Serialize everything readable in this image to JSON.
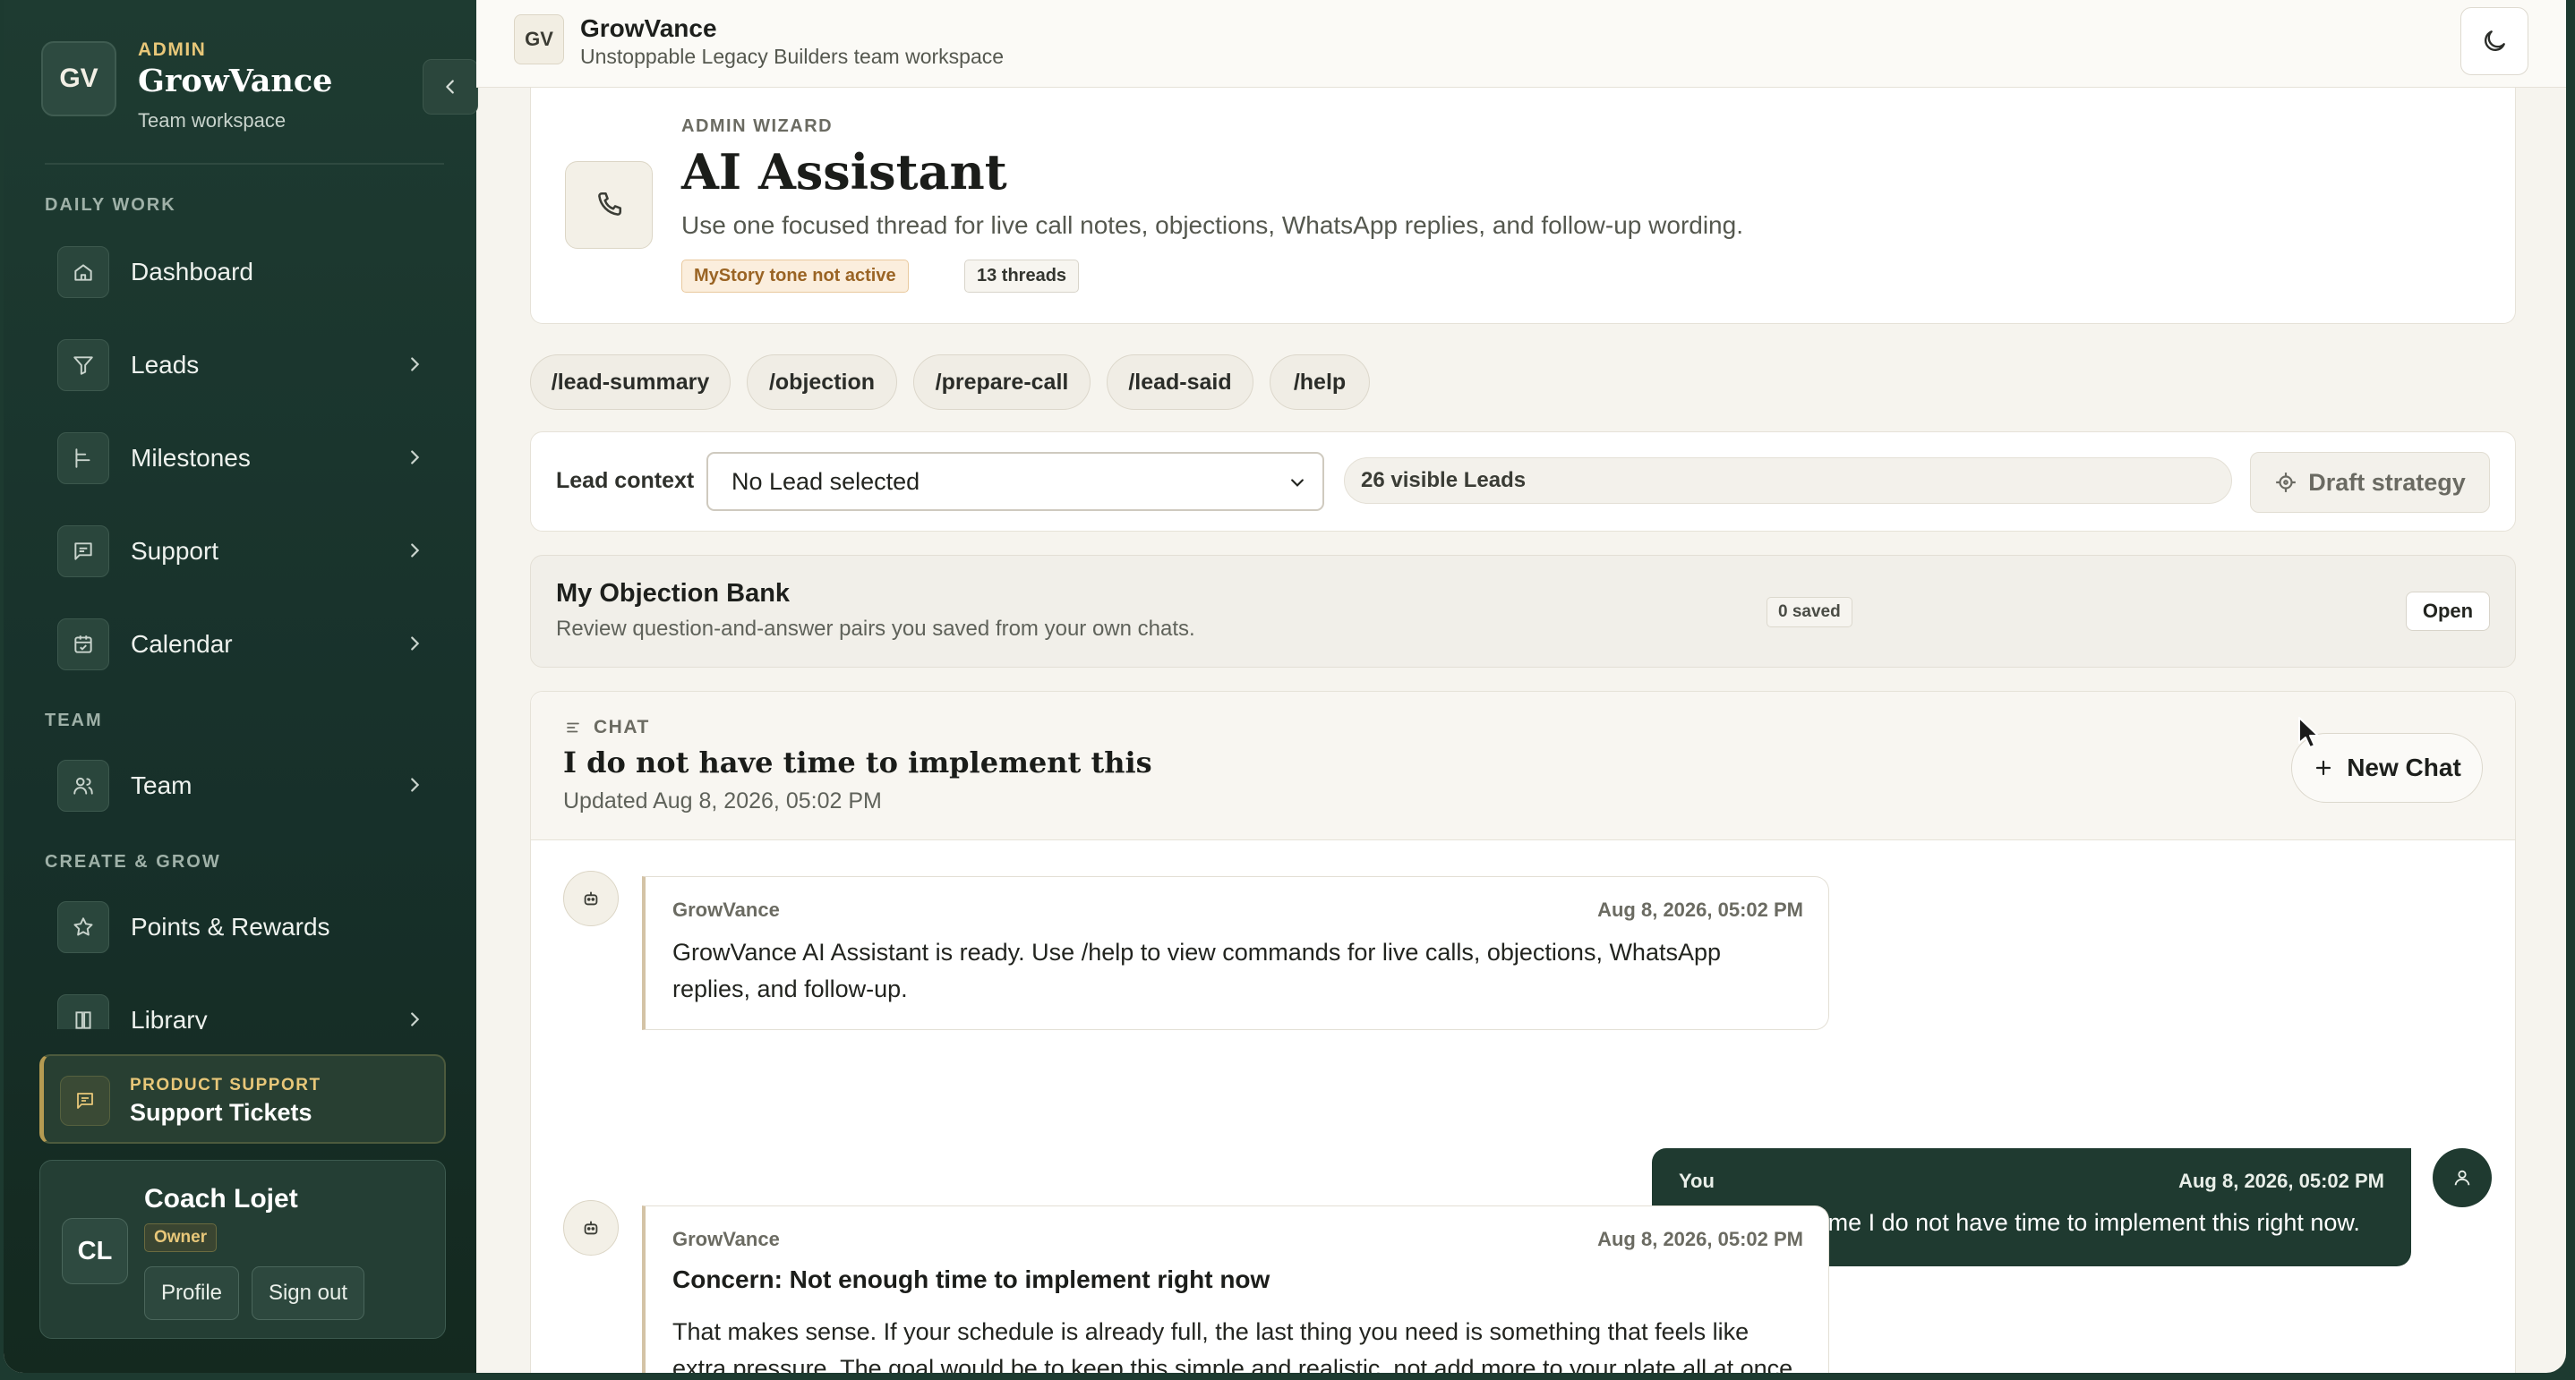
{
  "sidebar": {
    "role": "ADMIN",
    "brand_initials": "GV",
    "brand_name": "GrowVance",
    "brand_sub": "Team workspace",
    "sections": {
      "daily": "DAILY WORK",
      "team": "TEAM",
      "create": "CREATE & GROW"
    },
    "items": [
      {
        "label": "Dashboard",
        "icon": "home-icon"
      },
      {
        "label": "Leads",
        "icon": "filter-icon"
      },
      {
        "label": "Milestones",
        "icon": "milestone-icon"
      },
      {
        "label": "Support",
        "icon": "message-icon"
      },
      {
        "label": "Calendar",
        "icon": "calendar-icon"
      },
      {
        "label": "Team",
        "icon": "users-icon"
      },
      {
        "label": "Points & Rewards",
        "icon": "star-icon"
      },
      {
        "label": "Library",
        "icon": "book-icon"
      }
    ],
    "support": {
      "kicker": "PRODUCT SUPPORT",
      "title": "Support Tickets"
    },
    "user": {
      "initials": "CL",
      "name": "Coach Lojet",
      "role": "Owner",
      "profile_label": "Profile",
      "signout_label": "Sign out"
    }
  },
  "topbar": {
    "logo": "GV",
    "title": "GrowVance",
    "subtitle": "Unstoppable Legacy Builders team workspace"
  },
  "header": {
    "kicker": "ADMIN WIZARD",
    "title": "AI Assistant",
    "description": "Use one focused thread for live call notes, objections, WhatsApp replies, and follow-up wording.",
    "tone_badge": "MyStory tone not active",
    "threads_badge": "13 threads"
  },
  "commands": [
    "/lead-summary",
    "/objection",
    "/prepare-call",
    "/lead-said",
    "/help"
  ],
  "lead_context": {
    "label": "Lead context",
    "selected": "No Lead selected",
    "visible_count": "26 visible Leads",
    "draft_label": "Draft strategy"
  },
  "objection_bank": {
    "title": "My Objection Bank",
    "subtitle": "Review question-and-answer pairs you saved from your own chats.",
    "saved": "0 saved",
    "open_label": "Open"
  },
  "chat": {
    "kicker": "CHAT",
    "title": "I do not have time to implement this",
    "updated": "Updated Aug 8, 2026, 05:02 PM",
    "new_chat_label": "New Chat",
    "messages": [
      {
        "sender": "GrowVance",
        "time": "Aug 8, 2026, 05:02 PM",
        "text": "GrowVance AI Assistant is ready. Use /help to view commands for live calls, objections, WhatsApp replies, and follow-up."
      },
      {
        "sender": "You",
        "time": "Aug 8, 2026, 05:02 PM",
        "text": "/not-enough-time I do not have time to implement this right now."
      },
      {
        "sender": "GrowVance",
        "time": "Aug 8, 2026, 05:02 PM",
        "heading": "Concern: Not enough time to implement right now",
        "text": "That makes sense. If your schedule is already full, the last thing you need is something that feels like extra pressure. The goal would be to keep this simple and realistic, not add more to your plate all at once. We"
      }
    ]
  }
}
